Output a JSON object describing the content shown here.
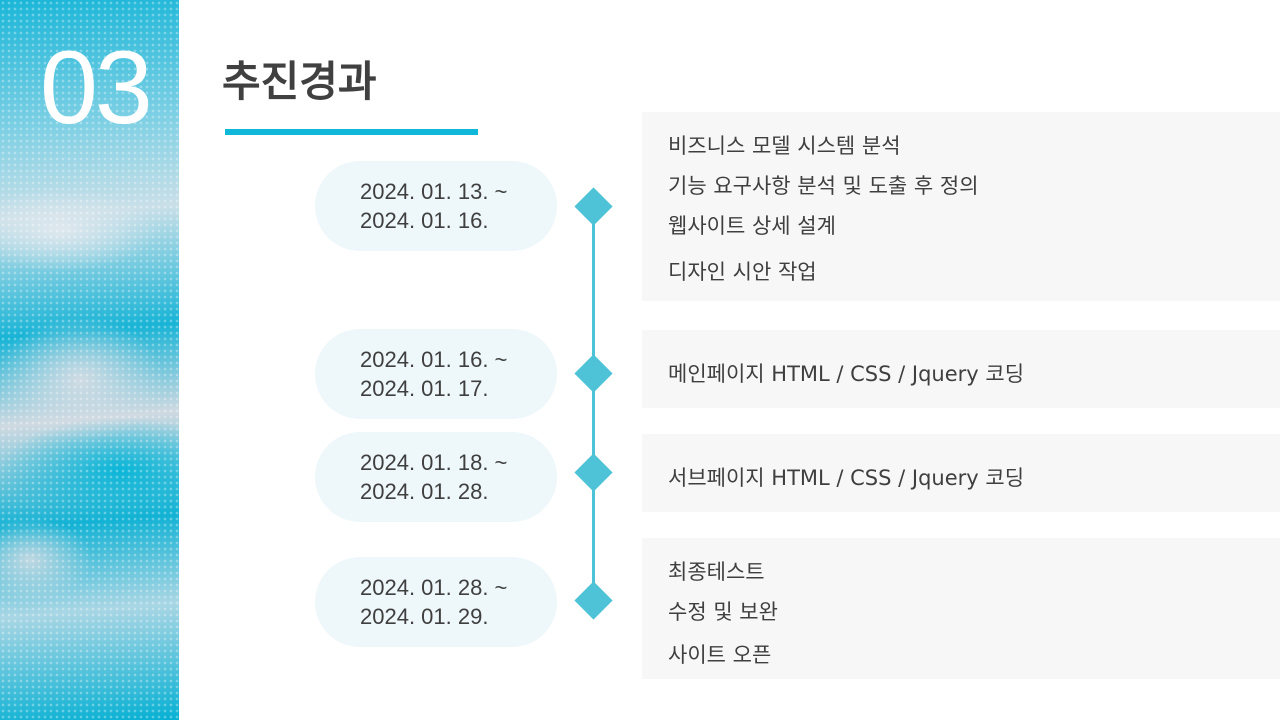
{
  "section": {
    "number": "03",
    "title": "추진경과"
  },
  "accent_color": "#0fb8d9",
  "timeline": [
    {
      "date_start": "2024. 01. 13. ~",
      "date_end": "2024. 01. 16.",
      "tasks": [
        "비즈니스 모델 시스템 분석",
        "기능 요구사항 분석 및 도출 후 정의",
        "웹사이트 상세 설계",
        "디자인 시안 작업"
      ]
    },
    {
      "date_start": "2024. 01. 16. ~",
      "date_end": "2024. 01. 17.",
      "tasks": [
        "메인페이지 HTML / CSS / Jquery 코딩"
      ]
    },
    {
      "date_start": "2024. 01. 18. ~",
      "date_end": "2024. 01. 28.",
      "tasks": [
        "서브페이지 HTML / CSS / Jquery 코딩"
      ]
    },
    {
      "date_start": "2024. 01. 28. ~",
      "date_end": "2024. 01. 29.",
      "tasks": [
        "최종테스트",
        "수정 및 보완",
        "사이트 오픈"
      ]
    }
  ]
}
